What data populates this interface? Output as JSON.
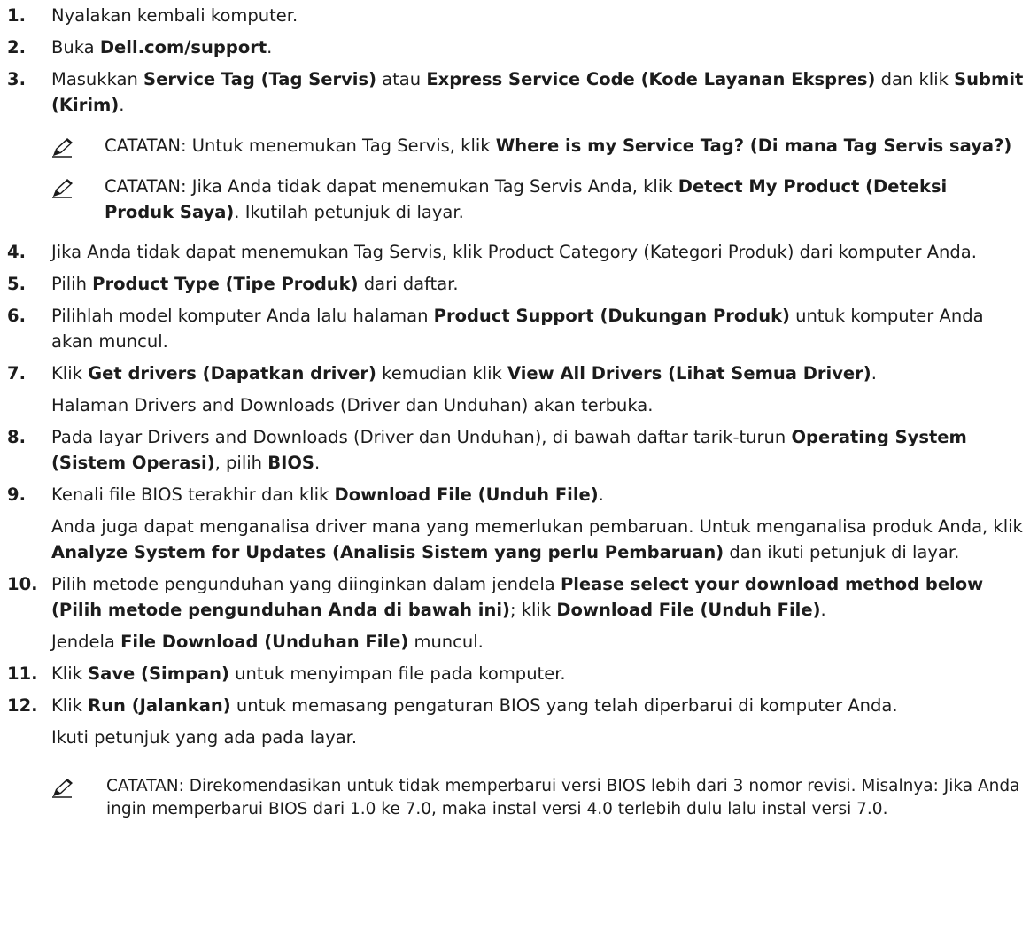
{
  "icons": {
    "note": "pencil-note-icon"
  },
  "steps": [
    {
      "num": "1.",
      "segs": [
        {
          "t": "Nyalakan kembali komputer.",
          "b": false
        }
      ]
    },
    {
      "num": "2.",
      "segs": [
        {
          "t": "Buka ",
          "b": false
        },
        {
          "t": "Dell.com/support",
          "b": true
        },
        {
          "t": ".",
          "b": false
        }
      ]
    },
    {
      "num": "3.",
      "segs": [
        {
          "t": "Masukkan ",
          "b": false
        },
        {
          "t": "Service Tag (Tag Servis)",
          "b": true
        },
        {
          "t": " atau ",
          "b": false
        },
        {
          "t": "Express Service Code (Kode Layanan Ekspres)",
          "b": true
        },
        {
          "t": " dan klik ",
          "b": false
        },
        {
          "t": "Submit (Kirim)",
          "b": true
        },
        {
          "t": ".",
          "b": false
        }
      ],
      "notes": [
        {
          "label": "CATATAN:",
          "segs": [
            {
              "t": " Untuk menemukan Tag Servis, klik ",
              "b": false
            },
            {
              "t": "Where is my Service Tag? (Di mana Tag Servis saya?)",
              "b": true
            }
          ]
        },
        {
          "label": "CATATAN:",
          "segs": [
            {
              "t": " Jika Anda tidak dapat menemukan Tag Servis Anda, klik ",
              "b": false
            },
            {
              "t": "Detect My Product (Deteksi Produk Saya)",
              "b": true
            },
            {
              "t": ". Ikutilah petunjuk di layar.",
              "b": false
            }
          ]
        }
      ]
    },
    {
      "num": "4.",
      "segs": [
        {
          "t": "Jika Anda tidak dapat menemukan Tag Servis, klik Product Category (Kategori Produk) dari komputer Anda.",
          "b": false
        }
      ]
    },
    {
      "num": "5.",
      "segs": [
        {
          "t": "Pilih ",
          "b": false
        },
        {
          "t": "Product Type (Tipe Produk)",
          "b": true
        },
        {
          "t": " dari daftar.",
          "b": false
        }
      ]
    },
    {
      "num": "6.",
      "segs": [
        {
          "t": "Pilihlah model komputer Anda lalu halaman ",
          "b": false
        },
        {
          "t": "Product Support (Dukungan Produk)",
          "b": true
        },
        {
          "t": " untuk komputer Anda akan muncul.",
          "b": false
        }
      ]
    },
    {
      "num": "7.",
      "segs": [
        {
          "t": "Klik ",
          "b": false
        },
        {
          "t": "Get drivers (Dapatkan driver)",
          "b": true
        },
        {
          "t": " kemudian klik ",
          "b": false
        },
        {
          "t": "View All Drivers (Lihat Semua Driver)",
          "b": true
        },
        {
          "t": ".",
          "b": false
        }
      ],
      "paras": [
        [
          {
            "t": "Halaman Drivers and Downloads (Driver dan Unduhan) akan terbuka.",
            "b": false
          }
        ]
      ]
    },
    {
      "num": "8.",
      "segs": [
        {
          "t": "Pada layar Drivers and Downloads (Driver dan Unduhan), di bawah daftar tarik-turun ",
          "b": false
        },
        {
          "t": "Operating System (Sistem Operasi)",
          "b": true
        },
        {
          "t": ", pilih ",
          "b": false
        },
        {
          "t": "BIOS",
          "b": true
        },
        {
          "t": ".",
          "b": false
        }
      ]
    },
    {
      "num": "9.",
      "segs": [
        {
          "t": "Kenali file BIOS terakhir dan klik ",
          "b": false
        },
        {
          "t": "Download File (Unduh File)",
          "b": true
        },
        {
          "t": ".",
          "b": false
        }
      ],
      "paras": [
        [
          {
            "t": "Anda juga dapat menganalisa driver mana yang memerlukan pembaruan. Untuk menganalisa produk Anda, klik ",
            "b": false
          },
          {
            "t": "Analyze System for Updates (Analisis Sistem yang perlu Pembaruan)",
            "b": true
          },
          {
            "t": " dan ikuti petunjuk di layar.",
            "b": false
          }
        ]
      ]
    },
    {
      "num": "10.",
      "segs": [
        {
          "t": "Pilih metode pengunduhan yang diinginkan dalam jendela ",
          "b": false
        },
        {
          "t": "Please select your download method below (Pilih metode pengunduhan Anda di bawah ini)",
          "b": true
        },
        {
          "t": "; klik ",
          "b": false
        },
        {
          "t": "Download File (Unduh File)",
          "b": true
        },
        {
          "t": ".",
          "b": false
        }
      ],
      "paras": [
        [
          {
            "t": "Jendela ",
            "b": false
          },
          {
            "t": "File Download (Unduhan File)",
            "b": true
          },
          {
            "t": " muncul.",
            "b": false
          }
        ]
      ]
    },
    {
      "num": "11.",
      "segs": [
        {
          "t": "Klik ",
          "b": false
        },
        {
          "t": "Save (Simpan)",
          "b": true
        },
        {
          "t": " untuk menyimpan file pada komputer.",
          "b": false
        }
      ]
    },
    {
      "num": "12.",
      "segs": [
        {
          "t": "Klik ",
          "b": false
        },
        {
          "t": "Run (Jalankan)",
          "b": true
        },
        {
          "t": " untuk memasang pengaturan BIOS yang telah diperbarui di komputer Anda.",
          "b": false
        }
      ],
      "paras": [
        [
          {
            "t": "Ikuti petunjuk yang ada pada layar.",
            "b": false
          }
        ]
      ]
    }
  ],
  "final_note": {
    "label": "CATATAN:",
    "segs": [
      {
        "t": " Direkomendasikan untuk tidak memperbarui versi BIOS lebih dari 3 nomor revisi. Misalnya: Jika Anda ingin memperbarui BIOS dari 1.0 ke 7.0, maka instal versi 4.0 terlebih dulu lalu instal versi 7.0.",
        "b": false
      }
    ]
  }
}
